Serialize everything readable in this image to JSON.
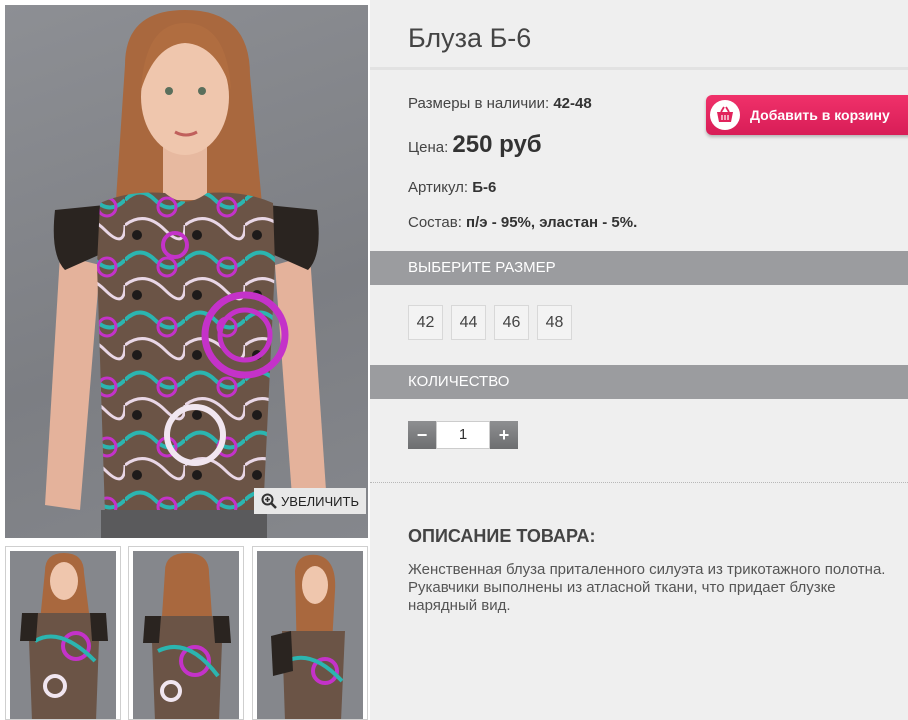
{
  "product": {
    "title": "Блуза Б-6",
    "sizes_label": "Размеры в наличии:",
    "sizes_value": "42-48",
    "price_label": "Цена:",
    "price_value": "250 руб",
    "article_label": "Артикул:",
    "article_value": "Б-6",
    "composition_label": "Состав:",
    "composition_value": "п/э - 95%, эластан - 5%.",
    "add_to_cart": "Добавить в корзину"
  },
  "gallery": {
    "zoom_label": "УВЕЛИЧИТЬ"
  },
  "size_section": {
    "header": "ВЫБЕРИТЕ РАЗМЕР",
    "options": [
      "42",
      "44",
      "46",
      "48"
    ]
  },
  "quantity_section": {
    "header": "КОЛИЧЕСТВО",
    "minus": "−",
    "value": "1",
    "plus": "+"
  },
  "description": {
    "header": "ОПИСАНИЕ ТОВАРА:",
    "text": "Женственная блуза приталенного силуэта из трикотажного полотна. Рукавчики выполнены из атласной ткани, что придает блузке нарядный вид."
  },
  "colors": {
    "cart_button": "#e1235c",
    "section_bar": "#9b9c9f",
    "panel_bg": "#efefef"
  }
}
